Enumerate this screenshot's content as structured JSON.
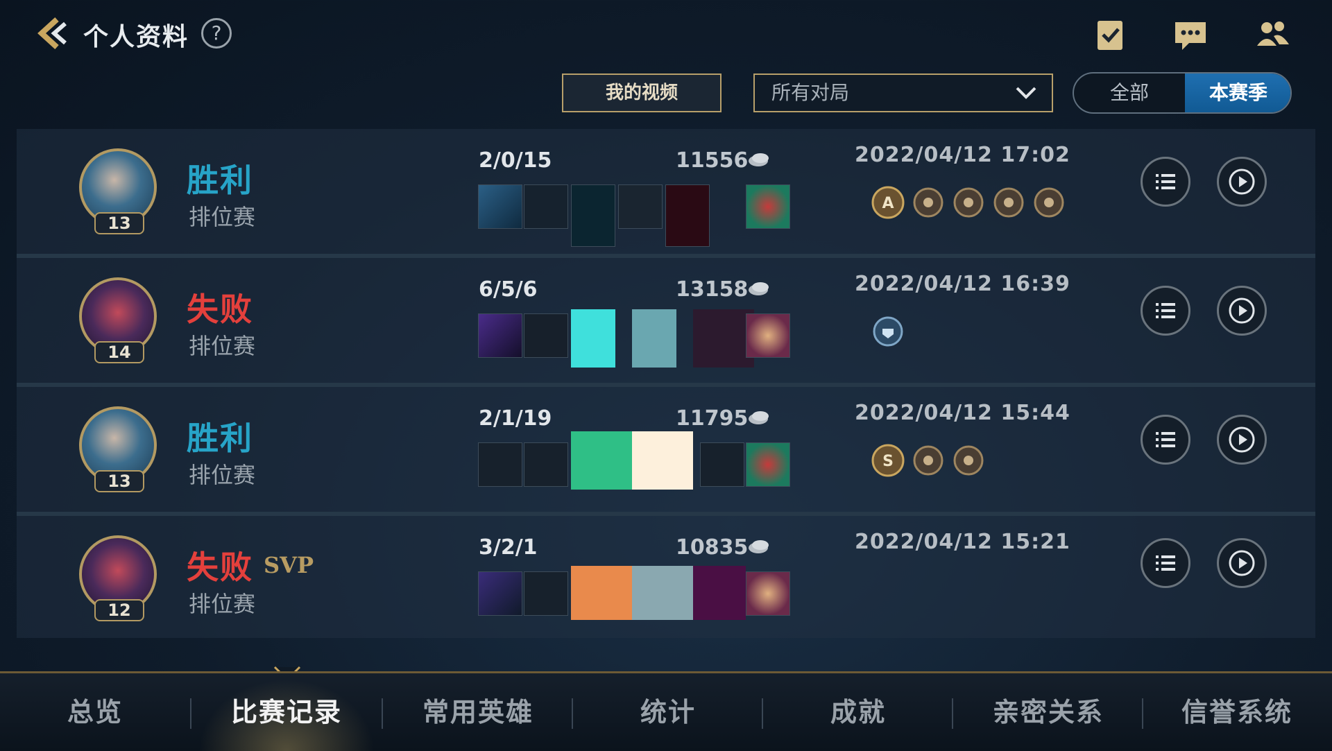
{
  "header": {
    "title": "个人资料",
    "help_icon": "?",
    "icons": [
      "checklist-icon",
      "chat-icon",
      "friends-icon"
    ]
  },
  "filters": {
    "video_button": "我的视频",
    "dropdown_value": "所有对局",
    "toggle": {
      "all": "全部",
      "season": "本赛季",
      "selected": "本赛季"
    }
  },
  "matches": [
    {
      "result": "胜利",
      "outcome": "win",
      "svp": "",
      "mode": "排位赛",
      "level": "13",
      "kda": "2/0/15",
      "gold": "11556",
      "time": "2022/04/12 17:02",
      "badge_count": 5
    },
    {
      "result": "失败",
      "outcome": "lose",
      "svp": "",
      "mode": "排位赛",
      "level": "14",
      "kda": "6/5/6",
      "gold": "13158",
      "time": "2022/04/12 16:39",
      "badge_count": 1
    },
    {
      "result": "胜利",
      "outcome": "win",
      "svp": "",
      "mode": "排位赛",
      "level": "13",
      "kda": "2/1/19",
      "gold": "11795",
      "time": "2022/04/12 15:44",
      "badge_count": 3
    },
    {
      "result": "失败",
      "outcome": "lose",
      "svp": "SVP",
      "mode": "排位赛",
      "level": "12",
      "kda": "3/2/1",
      "gold": "10835",
      "time": "2022/04/12 15:21",
      "badge_count": 0
    }
  ],
  "nav": {
    "tabs": [
      "总览",
      "比赛记录",
      "常用英雄",
      "统计",
      "成就",
      "亲密关系",
      "信誉系统"
    ],
    "active": "比赛记录"
  },
  "colors": {
    "win": "#27a4c8",
    "lose": "#e4403c",
    "gold_accent": "#b8a06a"
  }
}
